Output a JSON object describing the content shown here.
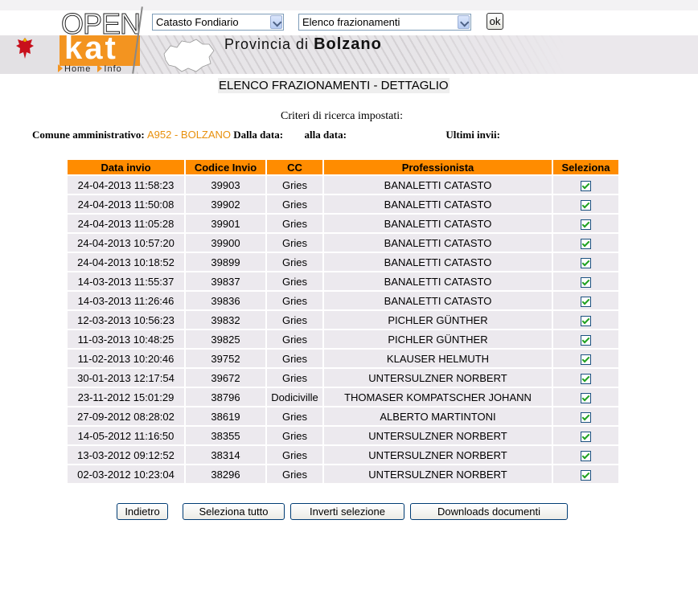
{
  "header": {
    "logo_open": "OPEN",
    "logo_kat": "kat",
    "provincia_text": "Provincia di",
    "provincia_bold": "Bolzano",
    "nav": [
      {
        "label": "Home"
      },
      {
        "label": "Info"
      }
    ],
    "select_catasto": "Catasto Fondiario",
    "select_elenco": "Elenco frazionamenti",
    "ok_label": "ok"
  },
  "page": {
    "title": "ELENCO FRAZIONAMENTI - DETTAGLIO",
    "criteria_title": "Criteri di ricerca impostati:",
    "criteria": {
      "comune_label": "Comune amministrativo:",
      "comune_value": "A952 - BOLZANO",
      "dalla_label": "Dalla data:",
      "alla_label": "alla data:",
      "ultimi_label": "Ultimi invii:"
    }
  },
  "table": {
    "headers": [
      "Data invio",
      "Codice Invio",
      "CC",
      "Professionista",
      "Seleziona"
    ],
    "rows": [
      {
        "data": "24-04-2013 11:58:23",
        "codice": "39903",
        "cc": "Gries",
        "prof": "BANALETTI CATASTO",
        "checked": true
      },
      {
        "data": "24-04-2013 11:50:08",
        "codice": "39902",
        "cc": "Gries",
        "prof": "BANALETTI CATASTO",
        "checked": true
      },
      {
        "data": "24-04-2013 11:05:28",
        "codice": "39901",
        "cc": "Gries",
        "prof": "BANALETTI CATASTO",
        "checked": true
      },
      {
        "data": "24-04-2013 10:57:20",
        "codice": "39900",
        "cc": "Gries",
        "prof": "BANALETTI CATASTO",
        "checked": true
      },
      {
        "data": "24-04-2013 10:18:52",
        "codice": "39899",
        "cc": "Gries",
        "prof": "BANALETTI CATASTO",
        "checked": true
      },
      {
        "data": "14-03-2013 11:55:37",
        "codice": "39837",
        "cc": "Gries",
        "prof": "BANALETTI CATASTO",
        "checked": true
      },
      {
        "data": "14-03-2013 11:26:46",
        "codice": "39836",
        "cc": "Gries",
        "prof": "BANALETTI CATASTO",
        "checked": true
      },
      {
        "data": "12-03-2013 10:56:23",
        "codice": "39832",
        "cc": "Gries",
        "prof": "PICHLER GÜNTHER",
        "checked": true
      },
      {
        "data": "11-03-2013 10:48:25",
        "codice": "39825",
        "cc": "Gries",
        "prof": "PICHLER GÜNTHER",
        "checked": true
      },
      {
        "data": "11-02-2013 10:20:46",
        "codice": "39752",
        "cc": "Gries",
        "prof": "KLAUSER HELMUTH",
        "checked": true
      },
      {
        "data": "30-01-2013 12:17:54",
        "codice": "39672",
        "cc": "Gries",
        "prof": "UNTERSULZNER NORBERT",
        "checked": true
      },
      {
        "data": "23-11-2012 15:01:29",
        "codice": "38796",
        "cc": "Dodiciville",
        "prof": "THOMASER KOMPATSCHER JOHANN",
        "checked": true
      },
      {
        "data": "27-09-2012 08:28:02",
        "codice": "38619",
        "cc": "Gries",
        "prof": "ALBERTO MARTINTONI",
        "checked": true
      },
      {
        "data": "14-05-2012 11:16:50",
        "codice": "38355",
        "cc": "Gries",
        "prof": "UNTERSULZNER NORBERT",
        "checked": true
      },
      {
        "data": "13-03-2012 09:12:52",
        "codice": "38314",
        "cc": "Gries",
        "prof": "UNTERSULZNER NORBERT",
        "checked": true
      },
      {
        "data": "02-03-2012 10:23:04",
        "codice": "38296",
        "cc": "Gries",
        "prof": "UNTERSULZNER NORBERT",
        "checked": true
      }
    ]
  },
  "buttons": {
    "indietro": "Indietro",
    "seleziona_tutto": "Seleziona tutto",
    "inverti": "Inverti selezione",
    "downloads": "Downloads documenti"
  },
  "colors": {
    "accent_orange": "#ff8c00",
    "logo_orange": "#f39420",
    "row_bg": "#ece9ee",
    "value_orange": "#e8900c"
  },
  "icons": {
    "eagle": "tyrol-eagle-icon",
    "region": "south-tyrol-map-icon",
    "nav_arrow": "arrow-right-icon",
    "check": "checkbox-checked-icon"
  }
}
